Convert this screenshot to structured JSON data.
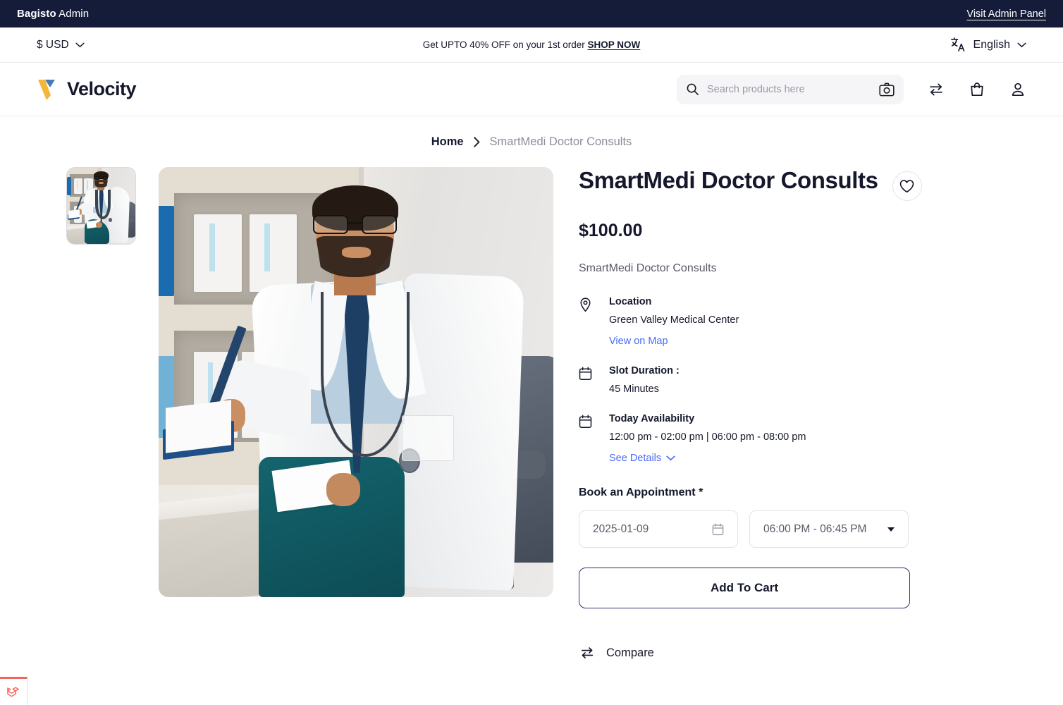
{
  "admin_bar": {
    "brand_bold": "Bagisto",
    "brand_light": " Admin",
    "visit_link": "Visit Admin Panel"
  },
  "promo_strip": {
    "currency": "$ USD",
    "promo_text": "Get UPTO 40% OFF on your 1st order ",
    "promo_cta": "SHOP NOW",
    "language": "English"
  },
  "header": {
    "logo_text": "Velocity",
    "search_placeholder": "Search products here",
    "search_value": "",
    "icons": {
      "compare": "compare-arrows-icon",
      "cart": "shopping-bag-icon",
      "account": "user-account-icon",
      "search": "search-icon",
      "camera": "camera-search-icon"
    }
  },
  "breadcrumb": {
    "home": "Home",
    "separator": "chevron-right-icon",
    "current": "SmartMedi Doctor Consults"
  },
  "product": {
    "title": "SmartMedi Doctor Consults",
    "price": "$100.00",
    "short_description": "SmartMedi Doctor Consults",
    "wishlist_icon": "heart-icon",
    "thumbnail_alt": "SmartMedi Doctor Consults thumbnail",
    "main_image_alt": "Doctor sitting at desk writing notes",
    "details": [
      {
        "icon": "map-pin-icon",
        "label": "Location",
        "value": "Green Valley Medical Center",
        "link": "View on Map",
        "link_icon": ""
      },
      {
        "icon": "calendar-icon",
        "label": "Slot Duration :",
        "value": "45 Minutes",
        "link": "",
        "link_icon": ""
      },
      {
        "icon": "calendar-icon",
        "label": "Today Availability",
        "value": "12:00 pm - 02:00 pm | 06:00 pm - 08:00 pm",
        "link": "See Details",
        "link_icon": "chevron-down-icon"
      }
    ],
    "booking": {
      "label": "Book an Appointment *",
      "date_value": "2025-01-09",
      "date_icon": "calendar-icon",
      "time_value": "06:00 PM - 06:45 PM",
      "time_icon": "caret-down-icon"
    },
    "add_to_cart": "Add To Cart",
    "compare": "Compare",
    "compare_icon": "compare-arrows-icon"
  },
  "debugbar": {
    "icon": "laravel-logo-icon",
    "accent": "#f4645f"
  },
  "colors": {
    "admin_bar_bg": "#141c3a",
    "link_blue": "#4a6cf7",
    "logo_amber": "#f5b63c",
    "logo_blue": "#4a7bb5",
    "text_dark": "#15182b",
    "text_muted": "#8d8d9b"
  }
}
